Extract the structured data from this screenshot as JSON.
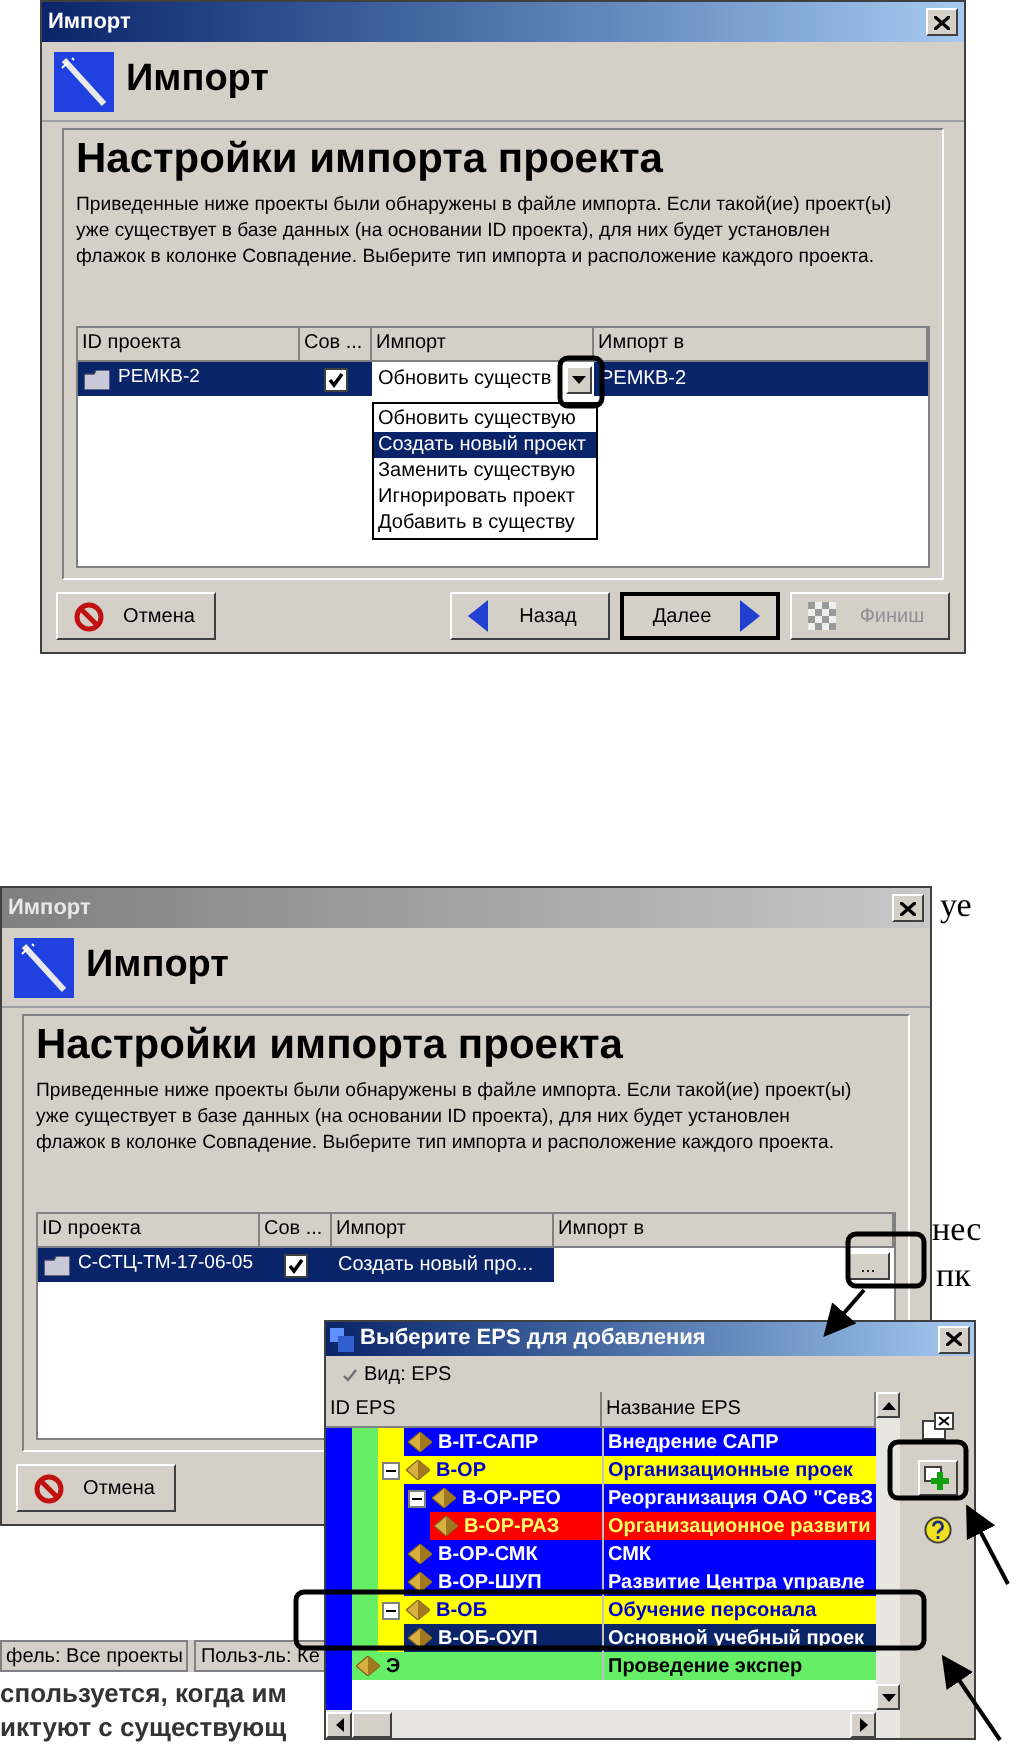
{
  "document_text": [
    "уе",
    "нес",
    "пк"
  ],
  "dialogs": [
    {
      "title": "Импорт",
      "active": true,
      "header": "Импорт",
      "heading": "Настройки импорта проекта",
      "description_lines": [
        "Приведенные ниже проекты были обнаружены в файле импорта. Если такой(ие) проект(ы)",
        "уже существует в базе данных (на основании ID проекта), для них будет установлен",
        "флажок в колонке Совпадение.  Выберите тип импорта и расположение каждого проекта."
      ],
      "columns": [
        "ID проекта",
        "Сов ...",
        "Импорт",
        "Импорт в"
      ],
      "rows": [
        {
          "id": "РЕМКВ-2",
          "match": true,
          "import": "Обновить существ",
          "editing": true,
          "import_to": "РЕМКВ-2",
          "selected": true
        }
      ],
      "dropdown": [
        {
          "label": "Обновить существую",
          "selected": false
        },
        {
          "label": "Создать новый проект",
          "selected": true
        },
        {
          "label": "Заменить существую",
          "selected": false
        },
        {
          "label": "Игнорировать проект",
          "selected": false
        },
        {
          "label": "Добавить в существу",
          "selected": false
        }
      ],
      "buttons": [
        {
          "kind": "cancel",
          "label": "Отмена",
          "disabled": false,
          "default": false
        },
        {
          "kind": "back",
          "label": "Назад",
          "disabled": false,
          "default": false
        },
        {
          "kind": "next",
          "label": "Далее",
          "disabled": false,
          "default": true
        },
        {
          "kind": "finish",
          "label": "Финиш",
          "disabled": true,
          "default": false
        }
      ]
    },
    {
      "title": "Импорт",
      "active": false,
      "header": "Импорт",
      "heading": "Настройки импорта проекта",
      "description_lines": [
        "Приведенные ниже проекты были обнаружены в файле импорта. Если такой(ие) проект(ы)",
        "уже существует в базе данных (на основании ID проекта), для них будет установлен",
        "флажок в колонке Совпадение.  Выберите тип импорта и расположение каждого проекта."
      ],
      "columns": [
        "ID проекта",
        "Сов ...",
        "Импорт",
        "Импорт в"
      ],
      "rows": [
        {
          "id": "С-СТЦ-ТМ-17-06-05",
          "match": true,
          "import": "Создать новый про...",
          "editing": false,
          "browse": "...",
          "selected": true
        }
      ],
      "buttons": [
        {
          "kind": "cancel",
          "label": "Отмена",
          "disabled": false,
          "default": false
        }
      ]
    }
  ],
  "status_bar": [
    "фель: Все проекты",
    "Польз-ль: Ке"
  ],
  "document_lines": [
    "спользуется, когда им",
    "иктуют с существующ"
  ],
  "eps_picker": {
    "title": "Выберите EPS для добавления",
    "view": "Вид: EPS",
    "columns": [
      "ID EPS",
      "Название EPS"
    ],
    "tree": [
      {
        "color": "#0000ff",
        "children": [
          {
            "color": "#66ee66",
            "children": [
              {
                "color": "#ffff00",
                "children": [
                  {
                    "id": "В-IT-САПР",
                    "name": "Внедрение САПР",
                    "color": "#0000ff",
                    "selected": false
                  }
                ]
              },
              {
                "id": "В-ОР",
                "name": "Организационные проек",
                "color": "#ffff00",
                "expanded": true,
                "selected": false,
                "children": [
                  {
                    "id": "В-ОР-РЕО",
                    "name": "Реорганизация ОАО \"СевЗ",
                    "color": "#0000ff",
                    "expanded": true,
                    "selected": false,
                    "children": [
                      {
                        "id": "В-ОР-РАЗ",
                        "name": "Организационное развити",
                        "color": "#ff0000",
                        "selected": false
                      }
                    ]
                  },
                  {
                    "id": "В-ОР-СМК",
                    "name": "СМК",
                    "color": "#0000ff",
                    "selected": false
                  },
                  {
                    "id": "В-ОР-ШУП",
                    "name": "Развитие Центра управле",
                    "color": "#0000ff",
                    "selected": false
                  }
                ]
              },
              {
                "id": "В-ОБ",
                "name": "Обучение персонала",
                "color": "#ffff00",
                "expanded": true,
                "selected": false,
                "children": [
                  {
                    "id": "В-ОБ-ОУП",
                    "name": "Основной учебный проек",
                    "selected": true
                  }
                ]
              }
            ]
          },
          {
            "id": "Э",
            "name": "Проведение экспер",
            "color": "#66ee66",
            "selected": false
          }
        ]
      }
    ]
  }
}
